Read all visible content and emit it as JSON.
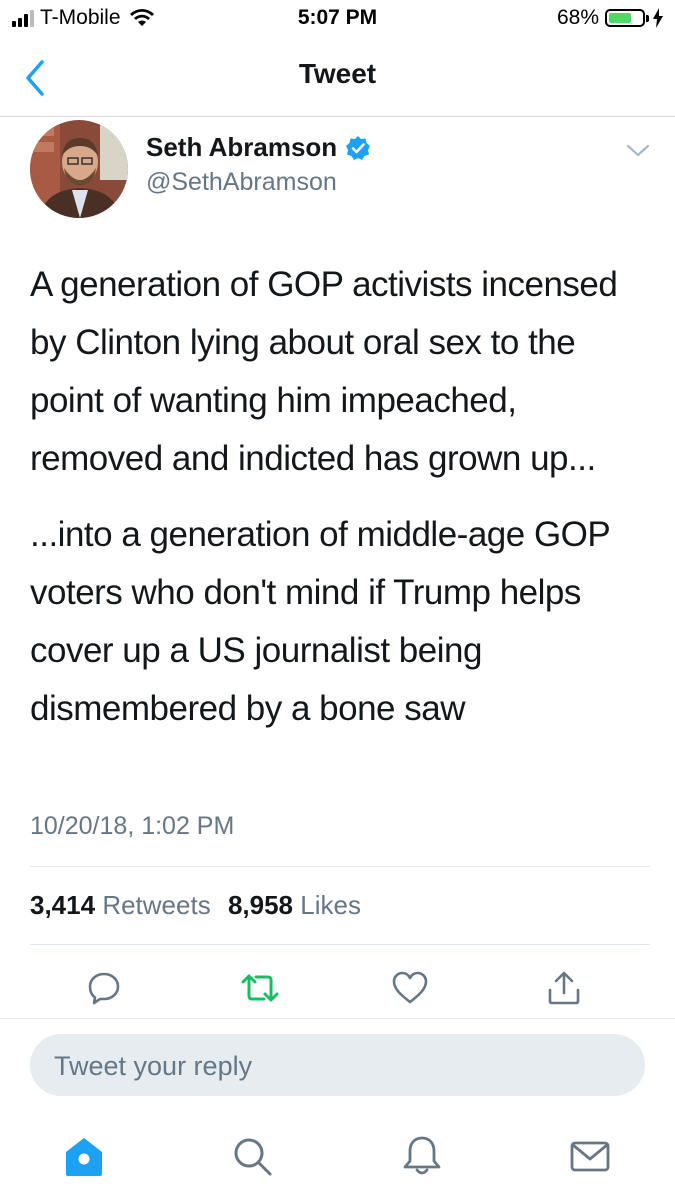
{
  "status_bar": {
    "carrier": "T-Mobile",
    "time": "5:07 PM",
    "battery_percent": "68%",
    "battery_level": 0.68,
    "icons": [
      "signal-icon",
      "wifi-icon",
      "battery-icon",
      "charging-bolt-icon"
    ]
  },
  "nav": {
    "title": "Tweet",
    "back_icon": "chevron-left-icon"
  },
  "tweet": {
    "author_name": "Seth Abramson",
    "verified": true,
    "handle": "@SethAbramson",
    "paragraphs": [
      "A generation of GOP activists incensed by Clinton lying about oral sex to the point of wanting him impeached, removed and indicted has grown up...",
      "...into a generation of middle-age GOP voters who don't mind if Trump helps cover up a US journalist being dismembered by a bone saw"
    ],
    "timestamp": "10/20/18, 1:02 PM",
    "retweets_count": "3,414",
    "retweets_label": "Retweets",
    "likes_count": "8,958",
    "likes_label": "Likes"
  },
  "actions": [
    "reply-icon",
    "retweet-icon",
    "like-icon",
    "share-icon"
  ],
  "reply": {
    "placeholder": "Tweet your reply"
  },
  "tab_bar": [
    "home-icon",
    "search-icon",
    "notifications-icon",
    "messages-icon"
  ],
  "colors": {
    "accent": "#1da1f2",
    "retweet": "#17bf63",
    "secondary_text": "#657786",
    "primary_text": "#14171a",
    "reply_bg": "#e6ecf0"
  }
}
